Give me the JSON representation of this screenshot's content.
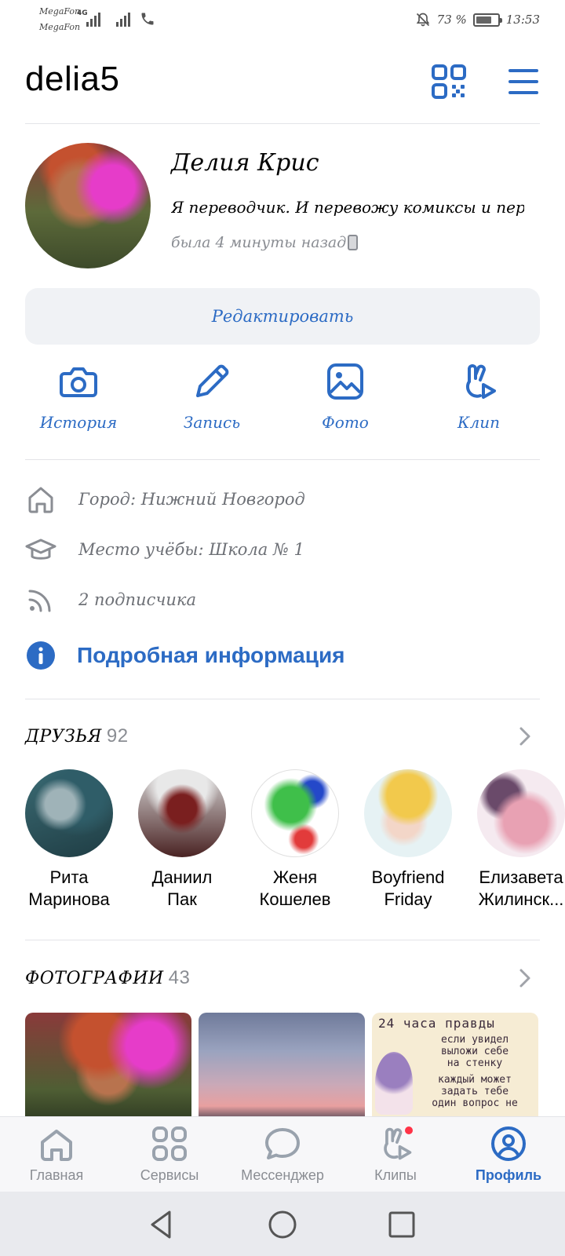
{
  "status_bar": {
    "carrier_1": "MegaFon",
    "carrier_2": "MegaFon",
    "network": "4G",
    "battery": "73 %",
    "battery_level": 0.73,
    "time": "13:53"
  },
  "header": {
    "username": "delia5"
  },
  "profile": {
    "name": "Делия Крис",
    "bio": "Я переводчик. И перевожу комиксы и перево...",
    "last_seen": "была 4 минуты назад",
    "edit_label": "Редактировать"
  },
  "actions": [
    {
      "label": "История",
      "icon": "camera-icon"
    },
    {
      "label": "Запись",
      "icon": "pencil-icon"
    },
    {
      "label": "Фото",
      "icon": "image-icon"
    },
    {
      "label": "Клип",
      "icon": "clip-icon"
    }
  ],
  "info": {
    "city": "Город: Нижний Новгород",
    "school": "Место учёбы: Школа № 1",
    "followers": "2 подписчика",
    "more": "Подробная информация"
  },
  "friends": {
    "title": "ДРУЗЬЯ",
    "count": "92",
    "items": [
      {
        "name_1": "Рита",
        "name_2": "Маринова"
      },
      {
        "name_1": "Даниил",
        "name_2": "Пак"
      },
      {
        "name_1": "Женя",
        "name_2": "Кошелев"
      },
      {
        "name_1": "Boyfriend",
        "name_2": "Friday"
      },
      {
        "name_1": "Елизавета",
        "name_2": "Жилинск..."
      }
    ]
  },
  "photos": {
    "title": "ФОТОГРАФИИ",
    "count": "43",
    "note_heading": "24 часа правды",
    "note_line_1": "если увидел",
    "note_line_2": "выложи себе",
    "note_line_3": "на стенку",
    "note_line_4": "каждый может",
    "note_line_5": "задать тебе",
    "note_line_6": "один вопрос не"
  },
  "bottom_nav": [
    {
      "label": "Главная",
      "icon": "home-icon"
    },
    {
      "label": "Сервисы",
      "icon": "services-icon"
    },
    {
      "label": "Мессенджер",
      "icon": "messenger-icon"
    },
    {
      "label": "Клипы",
      "icon": "clips-icon"
    },
    {
      "label": "Профиль",
      "icon": "profile-icon"
    }
  ],
  "colors": {
    "accent": "#2c6bc4",
    "muted_text": "#8a8d93",
    "badge": "#ff3347"
  }
}
